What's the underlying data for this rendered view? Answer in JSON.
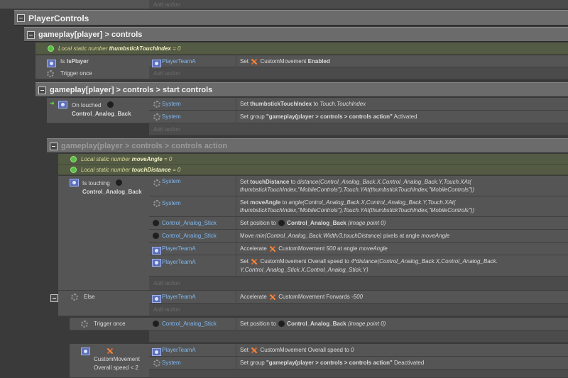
{
  "groups": {
    "player_controls": "PlayerControls",
    "controls": "gameplay[player] > controls",
    "start_controls": "gameplay[player] > controls > start controls",
    "controls_action": "gameplay(player > controls > controls action"
  },
  "add_action": "Add action",
  "locals": {
    "thumb_prefix": "Local static number",
    "thumb_name": "thumbstickTouchIndex",
    "thumb_value": "= 0",
    "angle_prefix": "Local static number",
    "angle_name": "moveAngle",
    "angle_value": "= 0",
    "dist_prefix": "Local static number",
    "dist_name": "touchDistance",
    "dist_value": "= 0"
  },
  "ev1": {
    "cond1_pre": "Is",
    "cond1_bold": "IsPlayer",
    "cond2": "Trigger once",
    "act_obj": "PlayerTeamA",
    "act_pre": "Set",
    "act_mid": "CustomMovement",
    "act_bold": "Enabled"
  },
  "ev2": {
    "cond_line1": "On touched",
    "cond_line2": "Control_Analog_Back",
    "a1_obj": "System",
    "a1_pre": "Set",
    "a1_bold": "thumbstickTouchIndex",
    "a1_mid": "to",
    "a1_it": "Touch.TouchIndex",
    "a2_obj": "System",
    "a2_pre": "Set group",
    "a2_bold": "\"gameplay(player > controls > controls action\"",
    "a2_post": "Activated"
  },
  "ev3": {
    "cond_line1": "Is touching",
    "cond_line2": "Control_Analog_Back",
    "a1_obj": "System",
    "a1_pre": "Set",
    "a1_bold": "touchDistance",
    "a1_mid": "to",
    "a1_it": "distance(Control_Analog_Back.X,Control_Analog_Back.Y,Touch.XAt( thumbstickTouchIndex,\"MobileControls\"),Touch.YAt(thumbstickTouchIndex,\"MobileControls\"))",
    "a2_obj": "System",
    "a2_pre": "Set",
    "a2_bold": "moveAngle",
    "a2_mid": "to",
    "a2_it": "angle(Control_Analog_Back.X,Control_Analog_Back.Y,Touch.XAt( thumbstickTouchIndex,\"MobileControls\"),Touch.YAt(thumbstickTouchIndex,\"MobileControls\"))",
    "a3_obj": "Control_Analog_Stick",
    "a3_pre": "Set position to",
    "a3_bold": "Control_Analog_Back",
    "a3_it": "(image point 0)",
    "a4_obj": "Control_Analog_Stick",
    "a4_pre": "Move",
    "a4_it": "min(Control_Analog_Back.Width/3,touchDistance)",
    "a4_mid": "pixels at angle",
    "a4_it2": "moveAngle",
    "a5_obj": "PlayerTeamA",
    "a5_pre": "Accelerate",
    "a5_mid": "CustomMovement",
    "a5_it": "500",
    "a5_mid2": "at angle",
    "a5_it2": "moveAngle",
    "a6_obj": "PlayerTeamA",
    "a6_pre": "Set",
    "a6_mid": "CustomMovement Overall speed to",
    "a6_it": "4*distance(Control_Analog_Back.X,Control_Analog_Back. Y,Control_Analog_Stick.X,Control_Analog_Stick.Y)"
  },
  "ev4": {
    "cond": "Else",
    "a1_obj": "PlayerTeamA",
    "a1_pre": "Accelerate",
    "a1_mid": "CustomMovement Forwards",
    "a1_it": "-500"
  },
  "ev5": {
    "cond": "Trigger once",
    "a1_obj": "Control_Analog_Stick",
    "a1_pre": "Set position to",
    "a1_bold": "Control_Analog_Back",
    "a1_it": "(image point 0)"
  },
  "ev6": {
    "cond_line1": "CustomMovement",
    "cond_line2": "Overall speed < 2",
    "a1_obj": "PlayerTeamA",
    "a1_pre": "Set",
    "a1_mid": "CustomMovement Overall speed to",
    "a1_it": "0",
    "a2_obj": "System",
    "a2_pre": "Set group",
    "a2_bold": "\"gameplay(player > controls > controls action\"",
    "a2_post": "Deactivated"
  }
}
